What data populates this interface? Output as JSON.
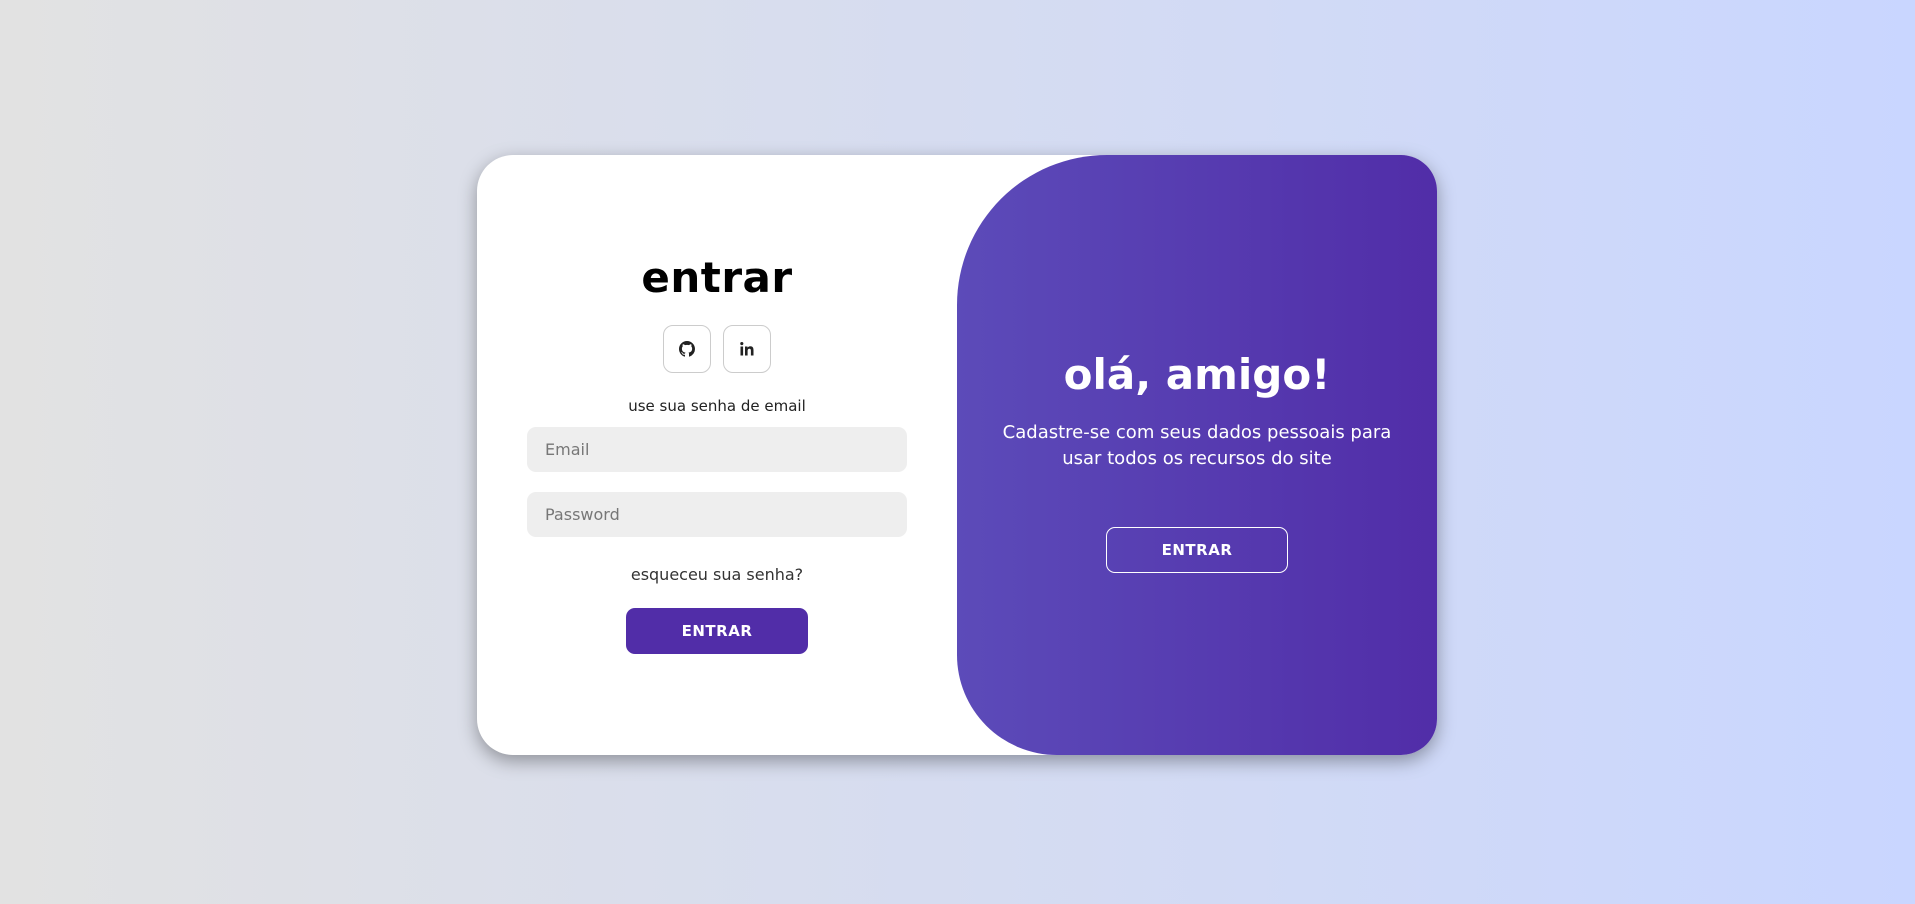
{
  "login": {
    "title": "entrar",
    "social": [
      {
        "icon": "github-icon",
        "label": "GitHub"
      },
      {
        "icon": "linkedin-icon",
        "label": "in"
      }
    ],
    "subtitle": "use sua senha de email",
    "email_placeholder": "Email",
    "password_placeholder": "Password",
    "forgot_text": "esqueceu sua senha?",
    "submit_label": "ENTRAR"
  },
  "toggle": {
    "title": "olá, amigo!",
    "text": "Cadastre-se com seus dados pessoais para usar todos os recursos do site",
    "button_label": "ENTRAR"
  },
  "colors": {
    "accent": "#512da8",
    "gradient_start": "#5c4bb9",
    "background_start": "#e2e2e2",
    "background_end": "#c9d6ff"
  }
}
